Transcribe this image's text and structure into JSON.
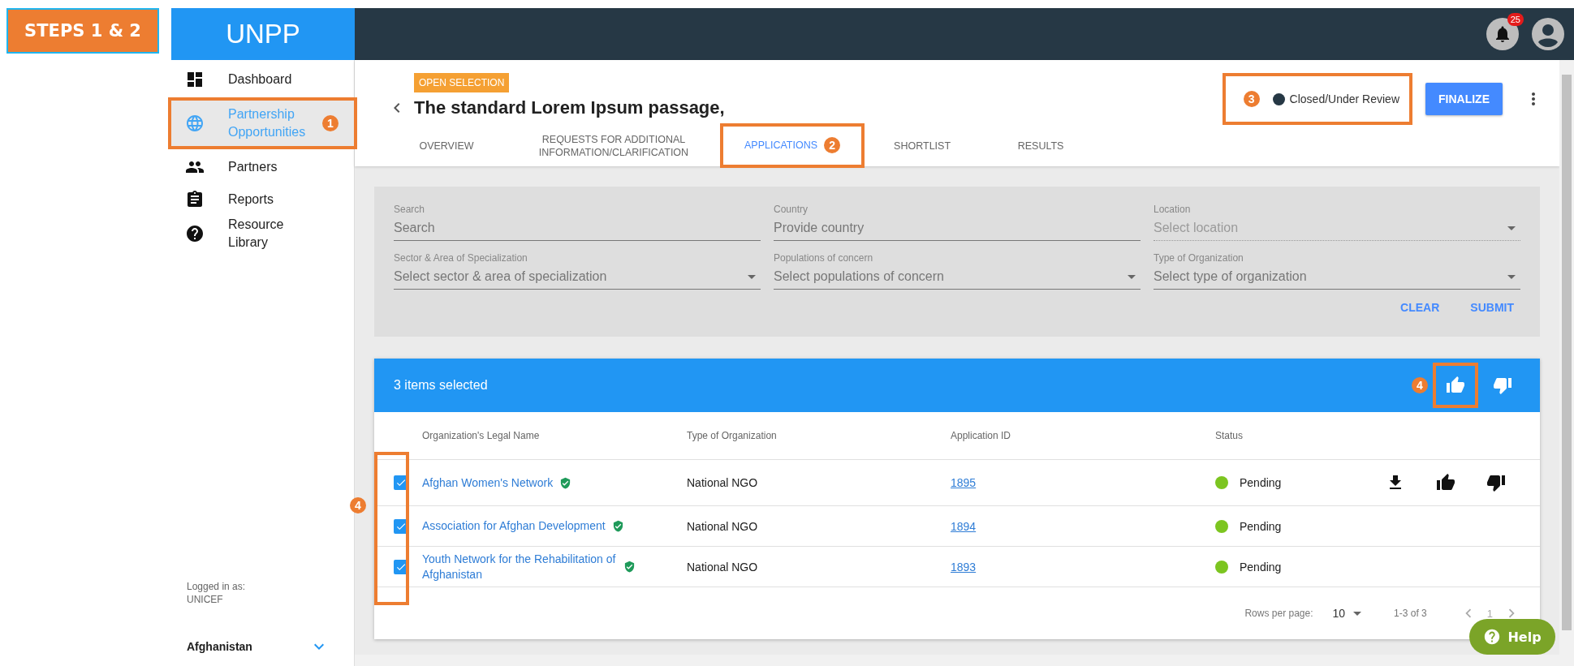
{
  "step_label": "STEPS 1 & 2",
  "topbar": {
    "logo": "UNPP",
    "notification_count": "25"
  },
  "sidebar": {
    "items": [
      {
        "label": "Dashboard",
        "selected": false
      },
      {
        "label": "Partnership Opportunities",
        "selected": true,
        "callout": "1"
      },
      {
        "label": "Partners",
        "selected": false
      },
      {
        "label": "Reports",
        "selected": false
      },
      {
        "label": "Resource Library",
        "selected": false
      }
    ],
    "logged_in_label": "Logged in as:",
    "logged_in_org": "UNICEF",
    "country": "Afghanistan"
  },
  "header": {
    "tag": "OPEN SELECTION",
    "title": "The standard Lorem Ipsum passage,",
    "status": "Closed/Under Review",
    "status_callout": "3",
    "finalize": "FINALIZE"
  },
  "tabs": [
    {
      "label": "OVERVIEW",
      "selected": false
    },
    {
      "label": "REQUESTS FOR ADDITIONAL INFORMATION/CLARIFICATION",
      "selected": false
    },
    {
      "label": "APPLICATIONS",
      "selected": true,
      "callout": "2"
    },
    {
      "label": "SHORTLIST",
      "selected": false
    },
    {
      "label": "RESULTS",
      "selected": false
    }
  ],
  "filters": {
    "fields": [
      {
        "label": "Search",
        "placeholder": "Search",
        "kind": "text",
        "disabled": false
      },
      {
        "label": "Country",
        "placeholder": "Provide country",
        "kind": "text",
        "disabled": false
      },
      {
        "label": "Location",
        "placeholder": "Select location",
        "kind": "select",
        "disabled": true
      },
      {
        "label": "Sector & Area of Specialization",
        "placeholder": "Select sector & area of specialization",
        "kind": "select",
        "disabled": false
      },
      {
        "label": "Populations of concern",
        "placeholder": "Select populations of concern",
        "kind": "select",
        "disabled": false
      },
      {
        "label": "Type of Organization",
        "placeholder": "Select type of organization",
        "kind": "select",
        "disabled": false
      }
    ],
    "buttons": [
      "CLEAR",
      "SUBMIT"
    ]
  },
  "table": {
    "selection_text": "3 items selected",
    "approve_callout": "4",
    "checkbox_callout": "4",
    "columns": [
      "Organization's Legal Name",
      "Type of Organization",
      "Application ID",
      "Status"
    ],
    "rows": [
      {
        "name": "Afghan Women's Network",
        "verified": true,
        "type": "National NGO",
        "id": "1895",
        "status": "Pending",
        "checked": true,
        "hovered": true
      },
      {
        "name": "Association for Afghan Development",
        "verified": true,
        "type": "National NGO",
        "id": "1894",
        "status": "Pending",
        "checked": true,
        "hovered": false
      },
      {
        "name": "Youth Network for the Rehabilitation of Afghanistan",
        "verified": true,
        "type": "National NGO",
        "id": "1893",
        "status": "Pending",
        "checked": true,
        "hovered": false
      }
    ],
    "footer": {
      "rows_per_page_label": "Rows per page:",
      "rows_per_page": "10",
      "range": "1-3 of 3",
      "page": "1"
    }
  },
  "help": "Help"
}
